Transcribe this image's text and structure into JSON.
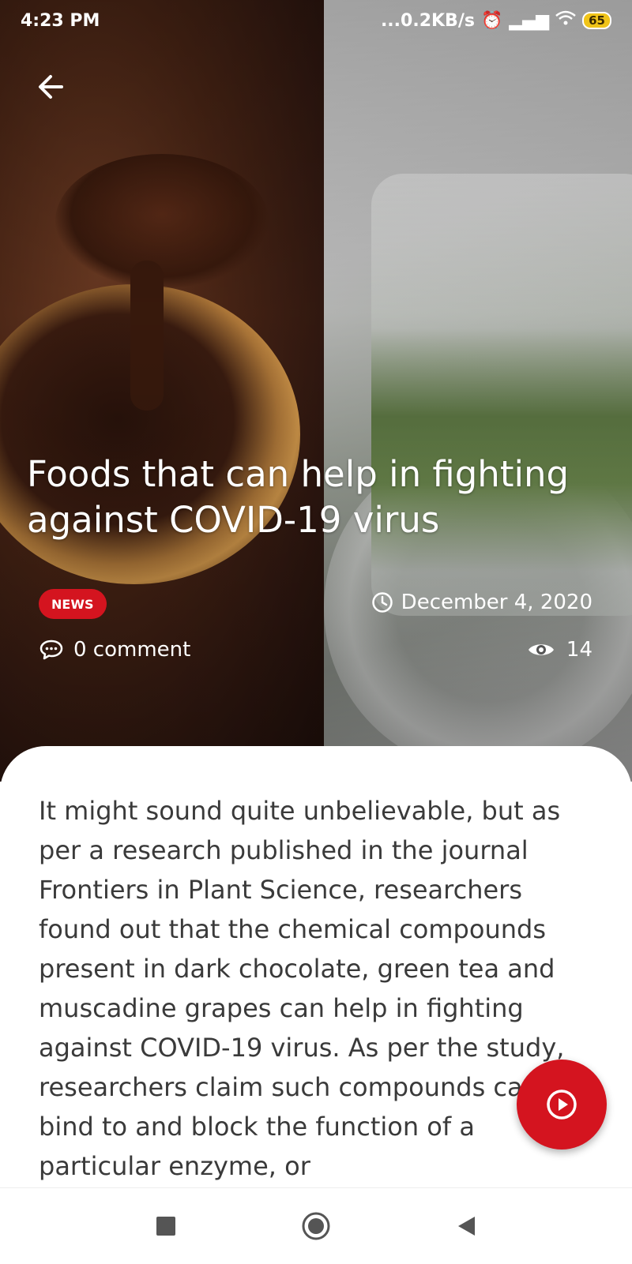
{
  "status_bar": {
    "time": "4:23 PM",
    "network_speed": "...0.2KB/s",
    "battery_level": "65"
  },
  "article": {
    "title": "Foods that can help in fighting against COVID-19 virus",
    "category": "NEWS",
    "date": "December 4, 2020",
    "comments": "0 comment",
    "views": "14",
    "body": "It might sound quite unbelievable, but as per a research published in the journal Frontiers in Plant Science, researchers found out that the chemical compounds present in dark chocolate, green tea and muscadine grapes can help in fighting against COVID-19 virus. As per the study, researchers claim such compounds can bind to and block the function of a particular enzyme, or"
  },
  "colors": {
    "accent": "#d4141f",
    "body_text": "#3a3a3a"
  },
  "icons": {
    "back": "arrow-left-icon",
    "clock": "clock-icon",
    "comment": "comment-bubble-icon",
    "views": "eye-icon",
    "play": "play-circle-icon"
  }
}
